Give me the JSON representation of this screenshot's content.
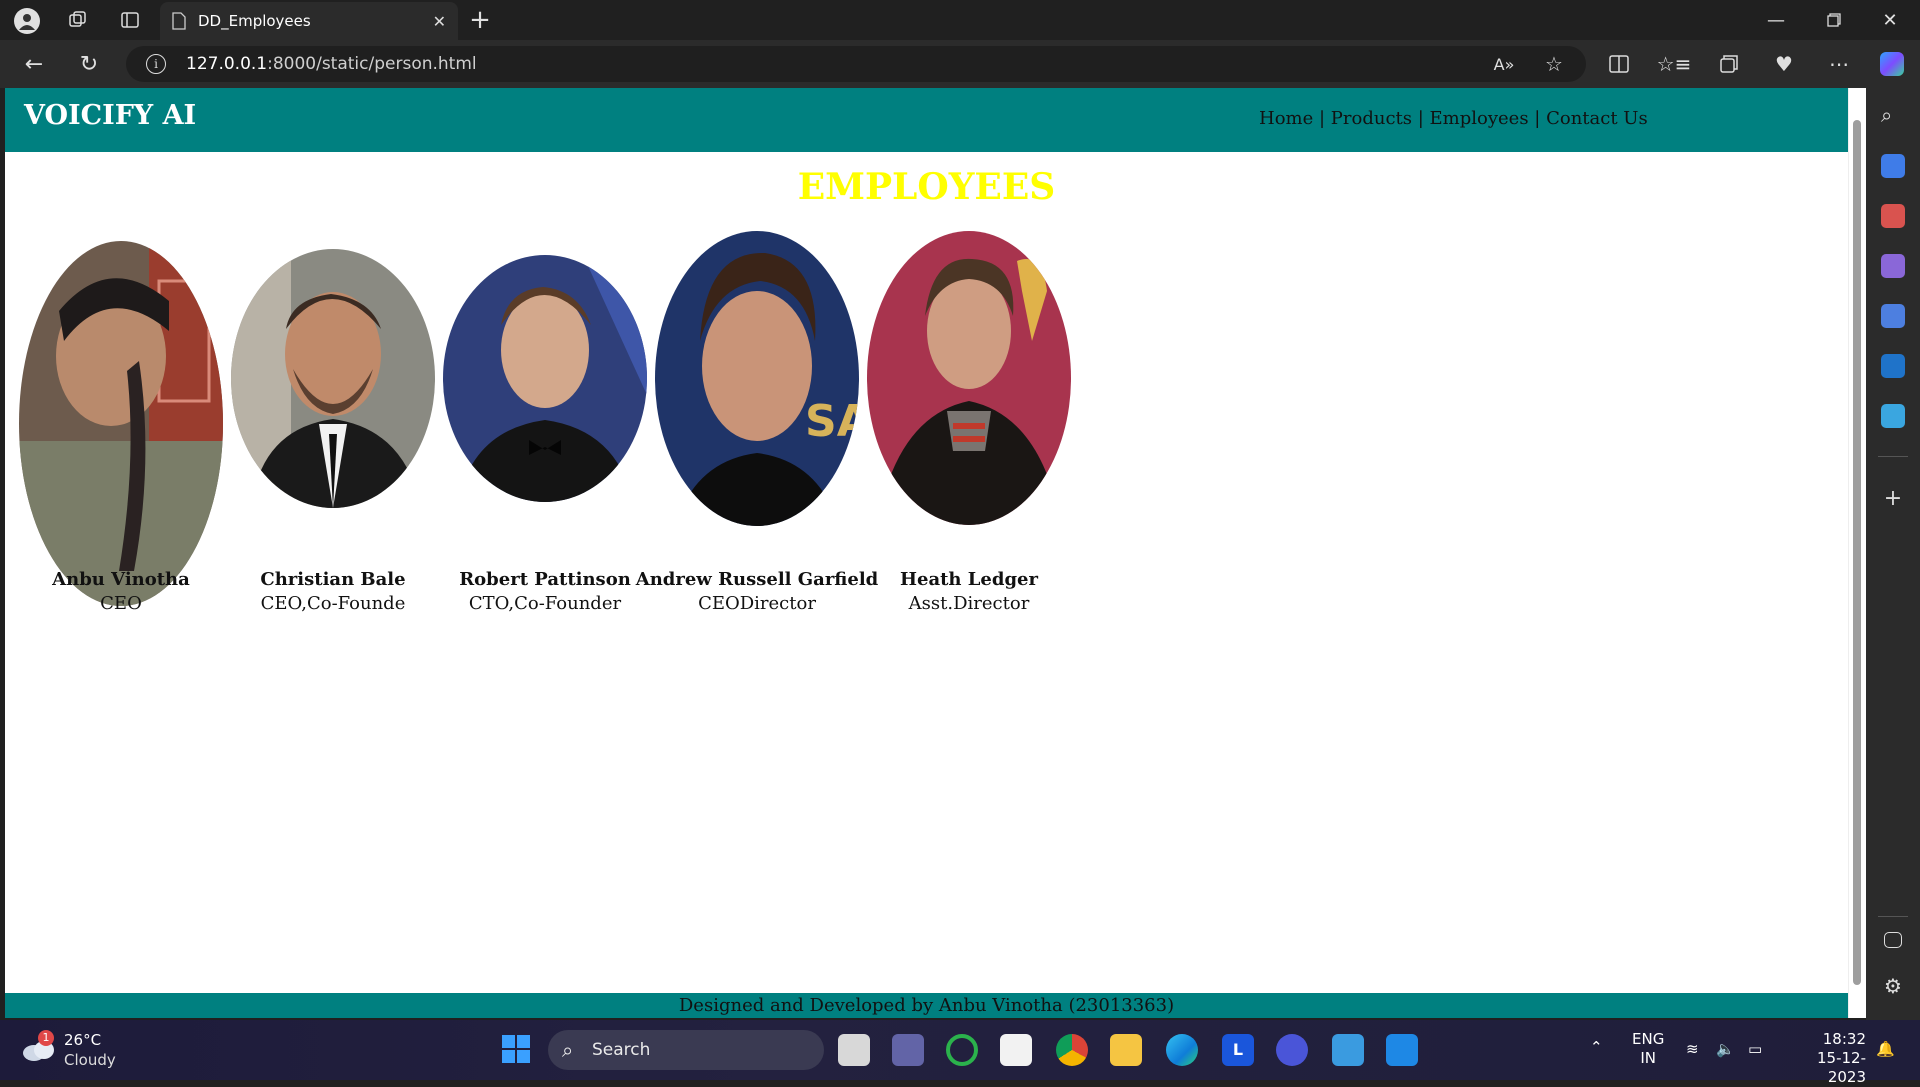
{
  "browser": {
    "tab_title": "DD_Employees",
    "url_host": "127.0.0.1",
    "url_rest": ":8000/static/person.html"
  },
  "site": {
    "brand": "VOICIFY AI",
    "nav": [
      "Home",
      "Products",
      "Employees",
      "Contact Us"
    ],
    "nav_separator": " | ",
    "heading": "EMPLOYEES",
    "employees": [
      {
        "name": "Anbu Vinotha",
        "role": "CEO"
      },
      {
        "name": "Christian Bale",
        "role": "CEO,Co-Founde"
      },
      {
        "name": "Robert Pattinson",
        "role": "CTO,Co-Founder"
      },
      {
        "name": "Andrew Russell Garfield",
        "role": "CEODirector"
      },
      {
        "name": "Heath Ledger",
        "role": "Asst.Director"
      }
    ],
    "footer": "Designed and Developed by Anbu Vinotha (23013363)",
    "colors": {
      "header": "#008080",
      "heading": "#ffff00"
    }
  },
  "taskbar": {
    "weather_temp": "26°C",
    "weather_cond": "Cloudy",
    "weather_badge": "1",
    "search_label": "Search",
    "lang_top": "ENG",
    "lang_bottom": "IN",
    "time": "18:32",
    "date": "15-12-2023"
  }
}
